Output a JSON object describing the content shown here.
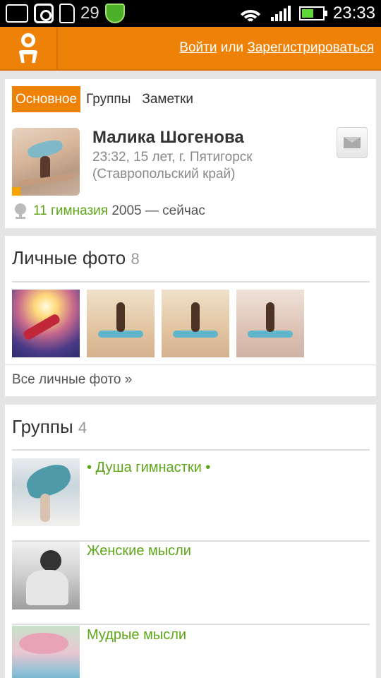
{
  "status_bar": {
    "notification_count": "29",
    "time": "23:33",
    "icons": [
      "edit-icon",
      "instagram-icon",
      "sd-card-icon",
      "shield-icon",
      "wifi-icon",
      "signal-icon",
      "battery-icon"
    ]
  },
  "header": {
    "login_label": "Войти",
    "or_label": "или",
    "register_label": "Зарегистрироваться",
    "brand_color": "#ee8208"
  },
  "profile": {
    "tabs": [
      {
        "label": "Основное",
        "active": true
      },
      {
        "label": "Группы",
        "active": false
      },
      {
        "label": "Заметки",
        "active": false
      }
    ],
    "name": "Малика Шогенова",
    "meta_line1": "23:32, 15 лет, г. Пятигорск",
    "meta_line2": "(Ставропольский край)",
    "school_name": "11 гимназия",
    "school_years": "2005 — сейчас"
  },
  "photos": {
    "title": "Личные фото",
    "count": "8",
    "all_link": "Все личные фото »"
  },
  "groups": {
    "title": "Группы",
    "count": "4",
    "items": [
      {
        "name": "• Душа гимнастки •"
      },
      {
        "name": "Женские мысли"
      },
      {
        "name": "Мудрые мысли"
      }
    ]
  }
}
